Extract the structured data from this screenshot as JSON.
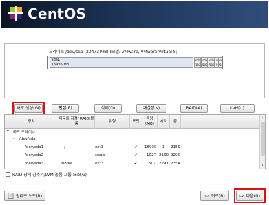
{
  "app": {
    "brand": "CentOS",
    "logo_icon": "centos-logo-icon"
  },
  "drive": {
    "title": "드라이브 /dev/sda (20473 MB) (모델: VMware, VMware Virtual S)",
    "segment_name": "sda1",
    "segment_size": "16935 MB",
    "small_segments": [
      "sda2",
      "sda3",
      "sda5",
      "sda6",
      "sda7"
    ],
    "small_sizes": [
      "1027",
      "502",
      "502",
      "502",
      "502"
    ]
  },
  "toolbar": {
    "new": "새로 생성(W)",
    "edit": "편집(E)",
    "delete": "삭제(D)",
    "reset": "재설정(s)",
    "raid": "RAID(A)",
    "lvm": "LVM(L)"
  },
  "table": {
    "headers": [
      "장치",
      "마운트 지점/ RAID/볼륨",
      "유형",
      "포맷",
      "용량 (MB)",
      "시작",
      "끝"
    ],
    "group": "하드 드라이브",
    "disk": "/dev/sda",
    "rows": [
      {
        "device": "/dev/sda1",
        "mount": "/",
        "type": "ext3",
        "format": "✔",
        "size": "16935",
        "start": "1",
        "end": "2159"
      },
      {
        "device": "/dev/sda2",
        "mount": "",
        "type": "swap",
        "format": "✔",
        "size": "1027",
        "start": "2160",
        "end": "2290"
      },
      {
        "device": "/dev/sda3",
        "mount": "/home",
        "type": "ext3",
        "format": "✔",
        "size": "502",
        "start": "2291",
        "end": "2354"
      }
    ]
  },
  "raid_checkbox": "RAID 장치 감추기/LVM 볼륨 그룹 요소(G)",
  "footer": {
    "release_notes": "릴리즈 노트(R)",
    "back": "뒤로(B)",
    "next": "다음(N)"
  },
  "colors": {
    "highlight": "#e01010",
    "banner": "#1d3458"
  }
}
